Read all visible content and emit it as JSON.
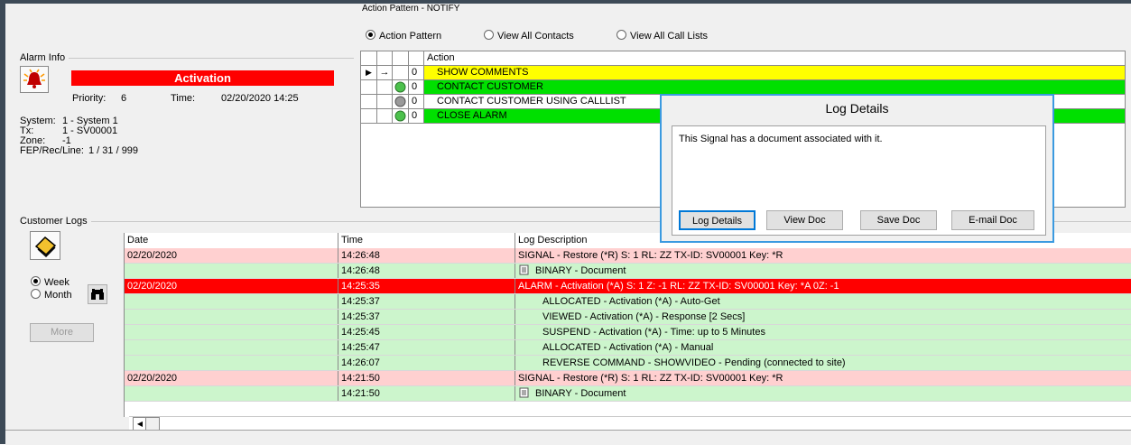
{
  "header": {
    "action_pattern_title": "Action Pattern - NOTIFY",
    "radio_action_pattern": "Action Pattern",
    "radio_view_all_contacts": "View All Contacts",
    "radio_view_all_call_lists": "View All Call Lists"
  },
  "alarm_info": {
    "group_label": "Alarm Info",
    "status": "Activation",
    "priority_label": "Priority:",
    "priority_value": "6",
    "time_label": "Time:",
    "time_value": "02/20/2020 14:25",
    "system_label": "System:",
    "system_value": "1 - System 1",
    "tx_label": "Tx:",
    "tx_value": "1 - SV00001",
    "zone_label": "Zone:",
    "zone_value": "-1",
    "fep_label": "FEP/Rec/Line:",
    "fep_value": "1 / 31 / 999"
  },
  "action_grid": {
    "header": "Action",
    "rows": [
      {
        "num": "0",
        "action": "SHOW COMMENTS",
        "color": "#ffff00",
        "light": "arrow"
      },
      {
        "num": "0",
        "action": "CONTACT CUSTOMER",
        "color": "#00e000",
        "light": "green"
      },
      {
        "num": "0",
        "action": "CONTACT CUSTOMER USING CALLLIST",
        "color": "#ffffff",
        "light": "grey"
      },
      {
        "num": "0",
        "action": "CLOSE ALARM",
        "color": "#00e000",
        "light": "green"
      }
    ]
  },
  "customer_logs": {
    "group_label": "Customer Logs",
    "radio_week": "Week",
    "radio_month": "Month",
    "more_button": "More",
    "columns": {
      "date": "Date",
      "time": "Time",
      "desc": "Log Description"
    },
    "rows": [
      {
        "date": "02/20/2020",
        "time": "14:26:48",
        "desc": "SIGNAL - Restore (*R) S: 1 RL: ZZ TX-ID: SV00001 Key: *R",
        "bg": "#ffd0d0",
        "fg": "#000000",
        "doc": false,
        "indent": false
      },
      {
        "date": "",
        "time": "14:26:48",
        "desc": "BINARY - Document",
        "bg": "#ccf5cc",
        "fg": "#000000",
        "doc": true,
        "indent": false
      },
      {
        "date": "02/20/2020",
        "time": "14:25:35",
        "desc": "ALARM - Activation (*A) S: 1 Z: -1 RL: ZZ TX-ID: SV00001 Key: *A 0Z: -1",
        "bg": "#ff0000",
        "fg": "#ffffff",
        "doc": false,
        "indent": false
      },
      {
        "date": "",
        "time": "14:25:37",
        "desc": "ALLOCATED - Activation (*A) - Auto-Get",
        "bg": "#ccf5cc",
        "fg": "#000000",
        "doc": false,
        "indent": true
      },
      {
        "date": "",
        "time": "14:25:37",
        "desc": "VIEWED - Activation (*A) - Response [2 Secs]",
        "bg": "#ccf5cc",
        "fg": "#000000",
        "doc": false,
        "indent": true
      },
      {
        "date": "",
        "time": "14:25:45",
        "desc": "SUSPEND - Activation (*A) - Time: up to 5 Minutes",
        "bg": "#ccf5cc",
        "fg": "#000000",
        "doc": false,
        "indent": true
      },
      {
        "date": "",
        "time": "14:25:47",
        "desc": "ALLOCATED - Activation (*A) - Manual",
        "bg": "#ccf5cc",
        "fg": "#000000",
        "doc": false,
        "indent": true
      },
      {
        "date": "",
        "time": "14:26:07",
        "desc": "REVERSE COMMAND - SHOWVIDEO - Pending (connected to site)",
        "bg": "#ccf5cc",
        "fg": "#000000",
        "doc": false,
        "indent": true
      },
      {
        "date": "02/20/2020",
        "time": "14:21:50",
        "desc": "SIGNAL - Restore (*R) S: 1 RL: ZZ TX-ID: SV00001 Key: *R",
        "bg": "#ffd0d0",
        "fg": "#000000",
        "doc": false,
        "indent": false
      },
      {
        "date": "",
        "time": "14:21:50",
        "desc": "BINARY - Document",
        "bg": "#ccf5cc",
        "fg": "#000000",
        "doc": true,
        "indent": false
      }
    ]
  },
  "dialog": {
    "title": "Log Details",
    "message": "This Signal has a document associated with it.",
    "btn_log_details": "Log Details",
    "btn_view_doc": "View Doc",
    "btn_save_doc": "Save Doc",
    "btn_email_doc": "E-mail Doc"
  }
}
